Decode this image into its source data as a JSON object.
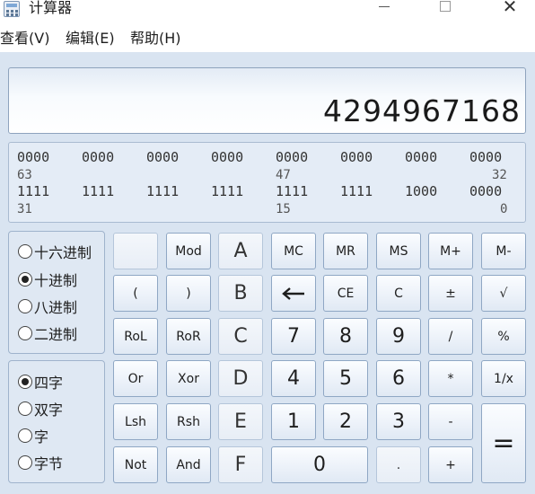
{
  "window": {
    "title": "计算器"
  },
  "menu": [
    {
      "label": "查看(V)"
    },
    {
      "label": "编辑(E)"
    },
    {
      "label": "帮助(H)"
    }
  ],
  "display": {
    "value": "4294967168"
  },
  "binary": {
    "row1": [
      "0000",
      "0000",
      "0000",
      "0000",
      "0000",
      "0000",
      "0000",
      "0000"
    ],
    "row1_labels": [
      "63",
      "47",
      "32"
    ],
    "row2": [
      "1111",
      "1111",
      "1111",
      "1111",
      "1111",
      "1111",
      "1000",
      "0000"
    ],
    "row2_labels": [
      "31",
      "15",
      "0"
    ]
  },
  "radix": {
    "options": [
      {
        "label": "十六进制"
      },
      {
        "label": "十进制"
      },
      {
        "label": "八进制"
      },
      {
        "label": "二进制"
      }
    ],
    "selected": "十进制"
  },
  "word_size": {
    "options": [
      {
        "label": "四字"
      },
      {
        "label": "双字"
      },
      {
        "label": "字"
      },
      {
        "label": "字节"
      }
    ],
    "selected": "四字"
  },
  "keys": {
    "blank": "",
    "mod": "Mod",
    "a": "A",
    "mc": "MC",
    "mr": "MR",
    "ms": "MS",
    "mplus": "M+",
    "mminus": "M-",
    "lparen": "(",
    "rparen": ")",
    "b": "B",
    "ce": "CE",
    "c": "C",
    "plusminus": "±",
    "sqrt": "√",
    "rol": "RoL",
    "ror": "RoR",
    "hex_c": "C",
    "n7": "7",
    "n8": "8",
    "n9": "9",
    "divide": "/",
    "percent": "%",
    "or": "Or",
    "xor": "Xor",
    "d": "D",
    "n4": "4",
    "n5": "5",
    "n6": "6",
    "multiply": "*",
    "reciprocal": "1/x",
    "lsh": "Lsh",
    "rsh": "Rsh",
    "e": "E",
    "n1": "1",
    "n2": "2",
    "n3": "3",
    "minus": "-",
    "equals": "=",
    "not": "Not",
    "and": "And",
    "f": "F",
    "n0": "0",
    "dot": ".",
    "plus": "+"
  },
  "colors": {
    "background": "#d9e4f1",
    "button_border": "#8fa7c4"
  }
}
